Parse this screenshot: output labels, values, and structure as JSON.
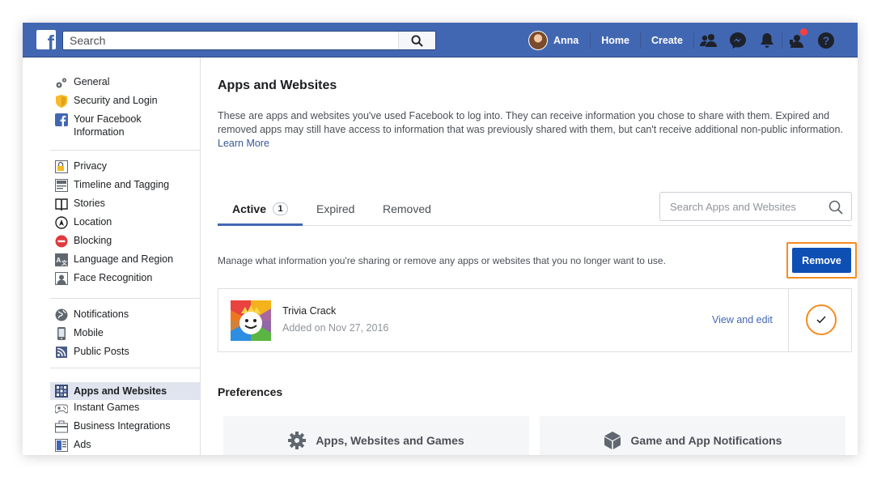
{
  "topbar": {
    "logo_letter": "f",
    "search_placeholder": "Search",
    "user_name": "Anna",
    "home_label": "Home",
    "create_label": "Create"
  },
  "sidebar": {
    "group1": [
      {
        "label": "General",
        "icon": "gears-icon"
      },
      {
        "label": "Security and Login",
        "icon": "shield-icon"
      },
      {
        "label": "Your Facebook Information",
        "icon": "facebook-square-icon"
      }
    ],
    "group2": [
      {
        "label": "Privacy",
        "icon": "privacy-lock-icon"
      },
      {
        "label": "Timeline and Tagging",
        "icon": "timeline-icon"
      },
      {
        "label": "Stories",
        "icon": "book-icon"
      },
      {
        "label": "Location",
        "icon": "location-icon"
      },
      {
        "label": "Blocking",
        "icon": "blocking-icon"
      },
      {
        "label": "Language and Region",
        "icon": "language-icon"
      },
      {
        "label": "Face Recognition",
        "icon": "face-recognition-icon"
      }
    ],
    "group3": [
      {
        "label": "Notifications",
        "icon": "globe-icon"
      },
      {
        "label": "Mobile",
        "icon": "mobile-icon"
      },
      {
        "label": "Public Posts",
        "icon": "rss-icon"
      }
    ],
    "group4": [
      {
        "label": "Apps and Websites",
        "icon": "apps-grid-icon",
        "active": true
      },
      {
        "label": "Instant Games",
        "icon": "gamepad-icon"
      },
      {
        "label": "Business Integrations",
        "icon": "business-icon"
      },
      {
        "label": "Ads",
        "icon": "ads-icon"
      }
    ]
  },
  "main": {
    "title": "Apps and Websites",
    "intro_text": "These are apps and websites you've used Facebook to log into. They can receive information you chose to share with them. Expired and removed apps may still have access to information that was previously shared with them, but can't receive additional non-public information.",
    "learn_more": "Learn More",
    "tabs": [
      {
        "label": "Active",
        "count": "1",
        "active": true
      },
      {
        "label": "Expired"
      },
      {
        "label": "Removed"
      }
    ],
    "search_placeholder": "Search Apps and Websites",
    "manage_text": "Manage what information you're sharing or remove any apps or websites that you no longer want to use.",
    "remove_label": "Remove",
    "app": {
      "name": "Trivia Crack",
      "added": "Added on Nov 27, 2016",
      "view_edit": "View and edit",
      "checked": true
    },
    "preferences_title": "Preferences",
    "pref_cards": [
      {
        "label": "Apps, Websites and Games",
        "icon": "gear-icon"
      },
      {
        "label": "Game and App Notifications",
        "icon": "cube-icon"
      }
    ]
  },
  "colors": {
    "topbar": "#4267b2",
    "primary_button": "#0e4fb4",
    "highlight": "#f68b1f",
    "link": "#385898"
  }
}
